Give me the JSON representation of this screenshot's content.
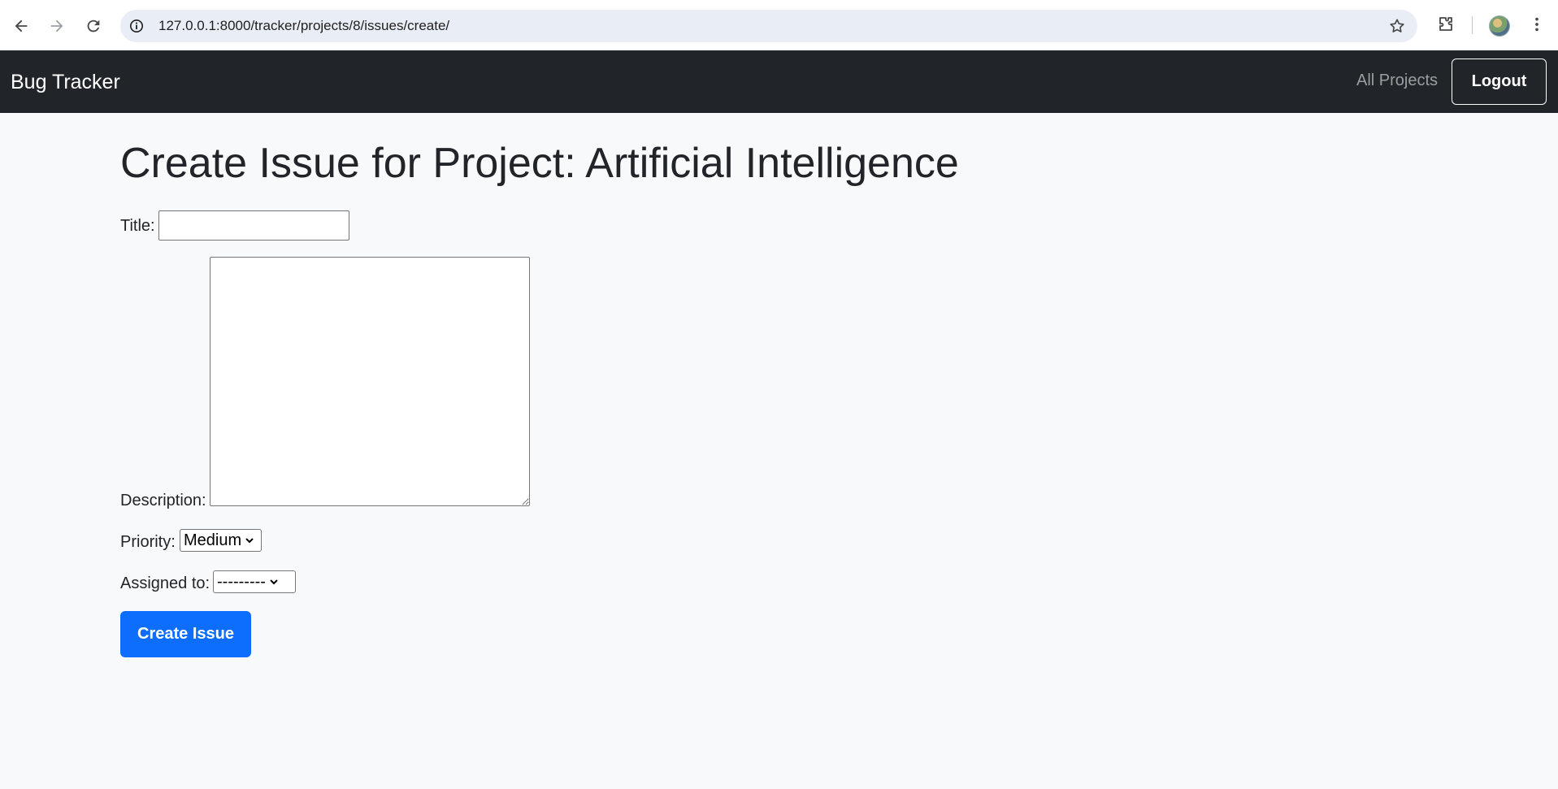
{
  "browser": {
    "url": "127.0.0.1:8000/tracker/projects/8/issues/create/",
    "icons": [
      "back-arrow-icon",
      "forward-arrow-icon",
      "reload-icon",
      "site-info-icon",
      "bookmark-star-icon",
      "extensions-icon",
      "profile-avatar",
      "more-menu-icon"
    ]
  },
  "navbar": {
    "brand": "Bug Tracker",
    "links": [
      "All Projects"
    ],
    "logout_label": "Logout"
  },
  "page": {
    "title": "Create Issue for Project: Artificial Intelligence"
  },
  "form": {
    "title_label": "Title:",
    "title_value": "",
    "description_label": "Description:",
    "description_value": "",
    "priority_label": "Priority:",
    "priority_selected": "Medium",
    "assigned_label": "Assigned to:",
    "assigned_selected": "---------",
    "submit_label": "Create Issue"
  },
  "colors": {
    "navbar_bg": "#212529",
    "page_bg": "#f8f9fa",
    "primary": "#0d6efd"
  }
}
